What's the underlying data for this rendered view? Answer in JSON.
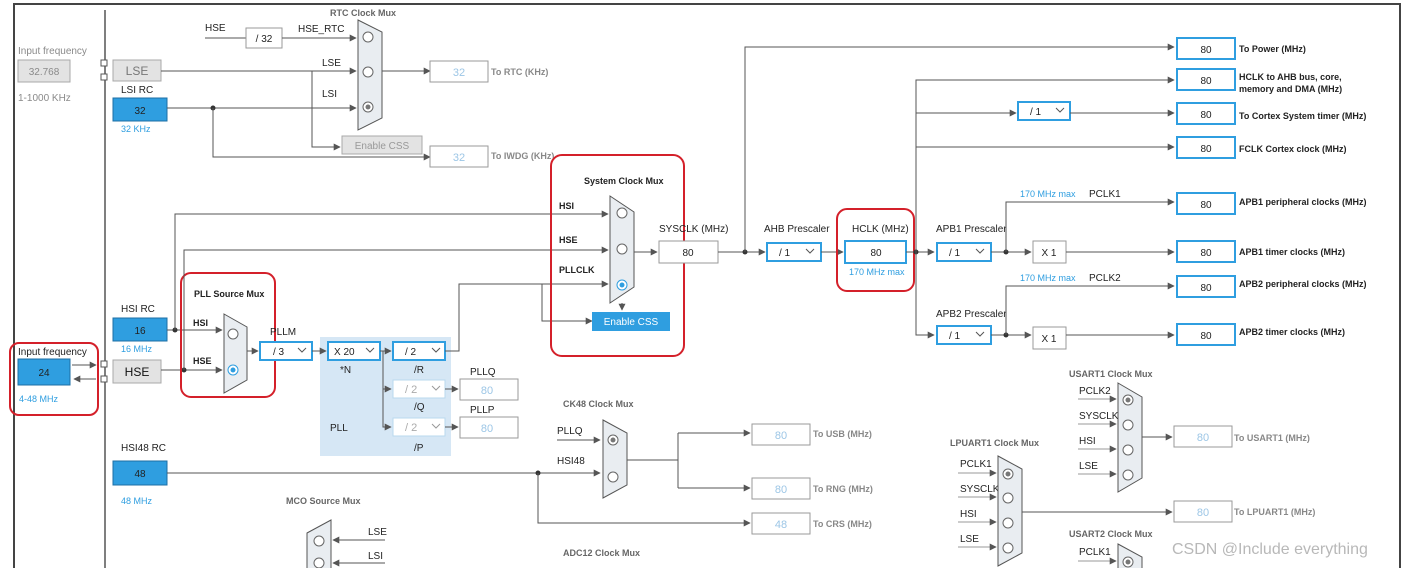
{
  "lse_input": {
    "label": "Input frequency",
    "value": "32.768",
    "range": "1-1000 KHz"
  },
  "hse_input": {
    "label": "Input frequency",
    "value": "24",
    "range": "4-48 MHz"
  },
  "lse": {
    "label": "LSE"
  },
  "hse": {
    "label": "HSE"
  },
  "lsi_rc": {
    "title": "LSI RC",
    "value": "32",
    "freq": "32 KHz"
  },
  "hsi_rc": {
    "title": "HSI RC",
    "value": "16",
    "freq": "16 MHz"
  },
  "hsi48_rc": {
    "title": "HSI48 RC",
    "value": "48",
    "freq": "48 MHz"
  },
  "rtc_mux": {
    "title": "RTC Clock Mux",
    "hse": "HSE",
    "hse_rtc": "HSE_RTC",
    "div": "/ 32",
    "lse": "LSE",
    "lsi": "LSI",
    "enable_css": "Enable CSS"
  },
  "rtc_out": {
    "value": "32",
    "label": "To RTC (KHz)"
  },
  "iwdg_out": {
    "value": "32",
    "label": "To IWDG (KHz)"
  },
  "pll_source": {
    "title": "PLL Source Mux",
    "hsi": "HSI",
    "hse": "HSE"
  },
  "pll": {
    "pllm_label": "PLLM",
    "pllm": "/ 3",
    "n": "X 20",
    "n_label": "*N",
    "r": "/ 2",
    "r_label": "/R",
    "q": "/ 2",
    "q_label": "/Q",
    "p": "/ 2",
    "p_label": "/P",
    "pll_label": "PLL",
    "pllq_label": "PLLQ",
    "pllq_value": "80",
    "pllp_label": "PLLP",
    "pllp_value": "80"
  },
  "sysclk_mux": {
    "title": "System Clock Mux",
    "hsi": "HSI",
    "hse": "HSE",
    "pllclk": "PLLCLK",
    "enable_css": "Enable CSS"
  },
  "sysclk": {
    "label": "SYSCLK (MHz)",
    "value": "80"
  },
  "ahb": {
    "label": "AHB Prescaler",
    "value": "/ 1"
  },
  "hclk": {
    "label": "HCLK (MHz)",
    "value": "80",
    "max": "170 MHz max"
  },
  "apb1": {
    "label": "APB1 Prescaler",
    "value": "/ 1",
    "max": "170 MHz max",
    "pclk": "PCLK1",
    "mult": "X 1"
  },
  "apb2": {
    "label": "APB2 Prescaler",
    "value": "/ 1",
    "max": "170 MHz max",
    "pclk": "PCLK2",
    "mult": "X 1"
  },
  "cortex_timer_div": {
    "value": "/ 1"
  },
  "outputs": {
    "power": {
      "value": "80",
      "label": "To Power (MHz)"
    },
    "hclk_ahb": {
      "value": "80",
      "label": "HCLK to AHB bus, core,",
      "label2": "memory and DMA (MHz)"
    },
    "cortex_timer": {
      "value": "80",
      "label": "To Cortex System timer (MHz)"
    },
    "fclk": {
      "value": "80",
      "label": "FCLK Cortex clock (MHz)"
    },
    "apb1_periph": {
      "value": "80",
      "label": "APB1 peripheral clocks (MHz)"
    },
    "apb1_timer": {
      "value": "80",
      "label": "APB1 timer clocks (MHz)"
    },
    "apb2_periph": {
      "value": "80",
      "label": "APB2 peripheral clocks (MHz)"
    },
    "apb2_timer": {
      "value": "80",
      "label": "APB2 timer clocks (MHz)"
    }
  },
  "ck48_mux": {
    "title": "CK48 Clock Mux",
    "pllq": "PLLQ",
    "hsi48": "HSI48"
  },
  "usb_out": {
    "value": "80",
    "label": "To USB (MHz)"
  },
  "rng_out": {
    "value": "80",
    "label": "To RNG (MHz)"
  },
  "crs_out": {
    "value": "48",
    "label": "To CRS (MHz)"
  },
  "mco_mux": {
    "title": "MCO Source Mux",
    "lse": "LSE",
    "lsi": "LSI"
  },
  "adc12_mux": {
    "title": "ADC12 Clock Mux"
  },
  "usart1_mux": {
    "title": "USART1 Clock Mux",
    "pclk2": "PCLK2",
    "sysclk": "SYSCLK",
    "hsi": "HSI",
    "lse": "LSE"
  },
  "usart1_out": {
    "value": "80",
    "label": "To USART1 (MHz)"
  },
  "lpuart1_mux": {
    "title": "LPUART1 Clock Mux",
    "pclk1": "PCLK1",
    "sysclk": "SYSCLK",
    "hsi": "HSI",
    "lse": "LSE"
  },
  "lpuart1_out": {
    "value": "80",
    "label": "To LPUART1 (MHz)"
  },
  "usart2_mux": {
    "title": "USART2 Clock Mux",
    "pclk1": "PCLK1"
  },
  "watermark": "CSDN @Include everything",
  "colors": {
    "accent": "#2f9ee0",
    "highlight": "#d4202a",
    "mux_fill": "#e9edf1"
  }
}
